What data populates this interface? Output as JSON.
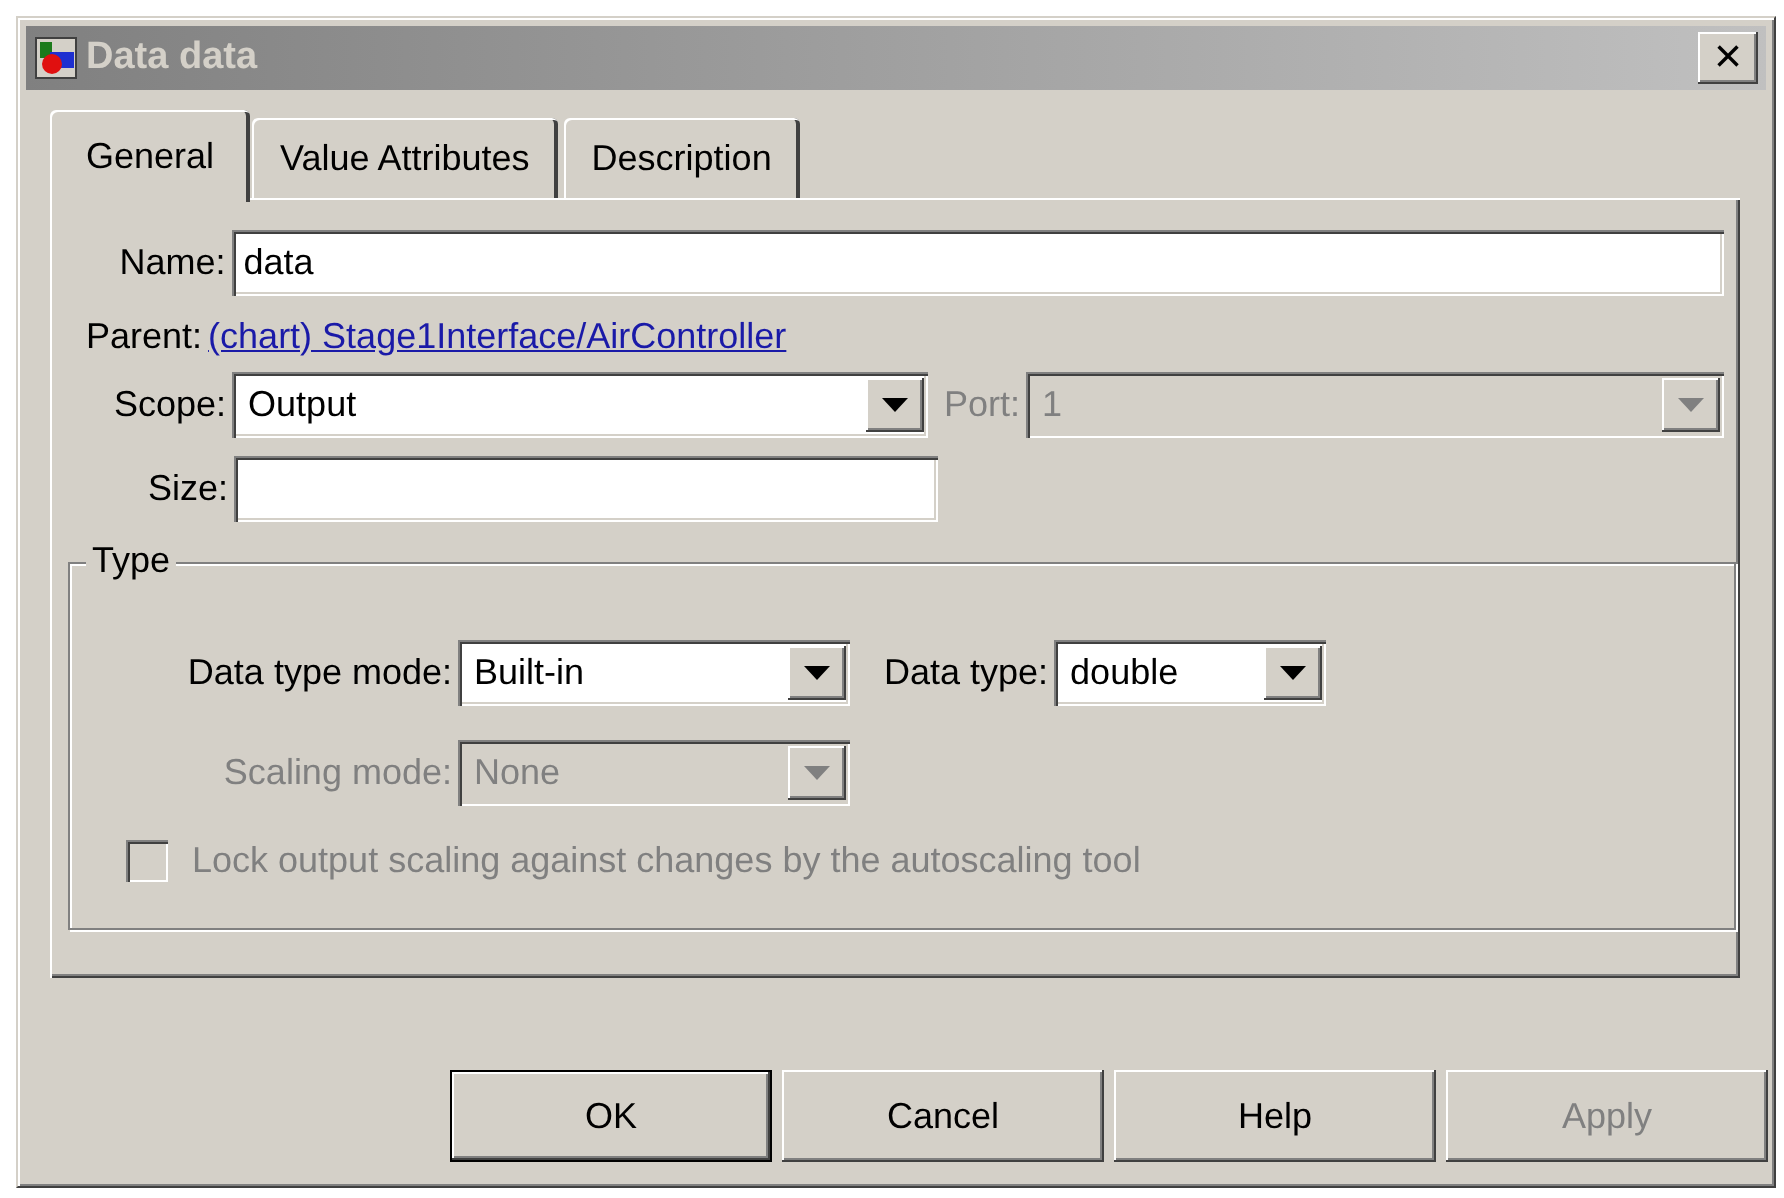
{
  "window": {
    "title": "Data data",
    "close": "×"
  },
  "tabs": [
    {
      "label": "General",
      "selected": true
    },
    {
      "label": "Value Attributes",
      "selected": false
    },
    {
      "label": "Description",
      "selected": false
    }
  ],
  "name": {
    "label": "Name:",
    "value": "data"
  },
  "parent": {
    "label": "Parent:",
    "link": "(chart) Stage1Interface/AirController"
  },
  "scope": {
    "label": "Scope:",
    "value": "Output",
    "disabled": false
  },
  "port": {
    "label": "Port:",
    "value": "1",
    "disabled": true
  },
  "size": {
    "label": "Size:"
  },
  "type_group": {
    "title": "Type",
    "data_type_mode": {
      "label": "Data type mode:",
      "value": "Built-in",
      "disabled": false
    },
    "data_type": {
      "label": "Data type:",
      "value": "double",
      "disabled": false
    },
    "scaling_mode": {
      "label": "Scaling mode:",
      "value": "None",
      "disabled": true
    },
    "lock_checkbox": {
      "label": "Lock output scaling against changes by the autoscaling tool",
      "checked": false,
      "disabled": true
    }
  },
  "buttons": [
    {
      "label": "OK",
      "disabled": false
    },
    {
      "label": "Cancel",
      "disabled": false
    },
    {
      "label": "Help",
      "disabled": false
    },
    {
      "label": "Apply",
      "disabled": true
    }
  ]
}
